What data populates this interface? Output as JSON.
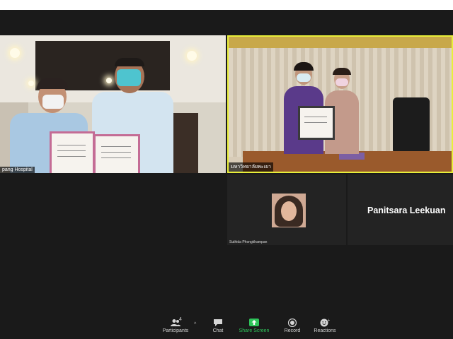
{
  "tiles": {
    "hospital": {
      "label": "pang Hospital"
    },
    "university": {
      "label": "มหาวิทยาลัยพะเยา"
    },
    "avatar": {
      "label": "Suthida Phongkhampan"
    },
    "name_tile": {
      "display_name": "Panitsara Leekuan"
    }
  },
  "toolbar": {
    "participants": {
      "label": "Participants",
      "count": "4",
      "icon": "participants-icon"
    },
    "chat": {
      "label": "Chat",
      "icon": "chat-icon"
    },
    "share_screen": {
      "label": "Share Screen",
      "icon": "share-screen-icon",
      "color": "#2ec45a"
    },
    "record": {
      "label": "Record",
      "icon": "record-icon"
    },
    "reactions": {
      "label": "Reactions",
      "icon": "reactions-icon"
    }
  },
  "colors": {
    "active_speaker_border": "#e8ef3a",
    "background": "#1a1a1a"
  }
}
